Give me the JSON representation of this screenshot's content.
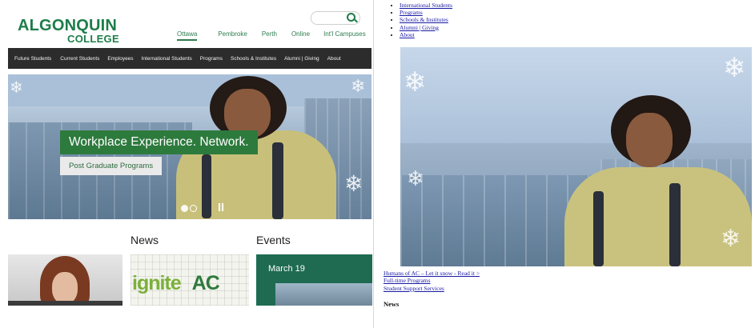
{
  "logo": {
    "line1": "ALGONQUIN",
    "line2": "COLLEGE",
    "brand_color": "#1d7d4a"
  },
  "search": {
    "placeholder": "",
    "icon": "search-icon"
  },
  "campus_nav": [
    "Ottawa",
    "Pembroke",
    "Perth",
    "Online",
    "Int'l Campuses"
  ],
  "main_nav": [
    "Future Students",
    "Current Students",
    "Employees",
    "International Students",
    "Programs",
    "Schools & Institutes",
    "Alumni | Giving",
    "About"
  ],
  "hero": {
    "headline": "Workplace Experience. Network.",
    "cta": "Post Graduate Programs",
    "headline_color": "#2d7a3d",
    "slide_count": 2,
    "active_slide": 1
  },
  "sections": {
    "news": "News",
    "events": "Events"
  },
  "news_card": {
    "brand_left": "ignite",
    "brand_right": "AC"
  },
  "event_card": {
    "date": "March 19",
    "bg_color": "#1e6b52"
  },
  "fallback": {
    "list": [
      "International Students",
      "Programs",
      "Schools & Institutes",
      "Alumni | Giving",
      "About"
    ],
    "links": [
      "Humans of AC – Let it snow - Read it >",
      "Full-time Programs",
      "Student Support Services"
    ],
    "news_heading": "News"
  }
}
